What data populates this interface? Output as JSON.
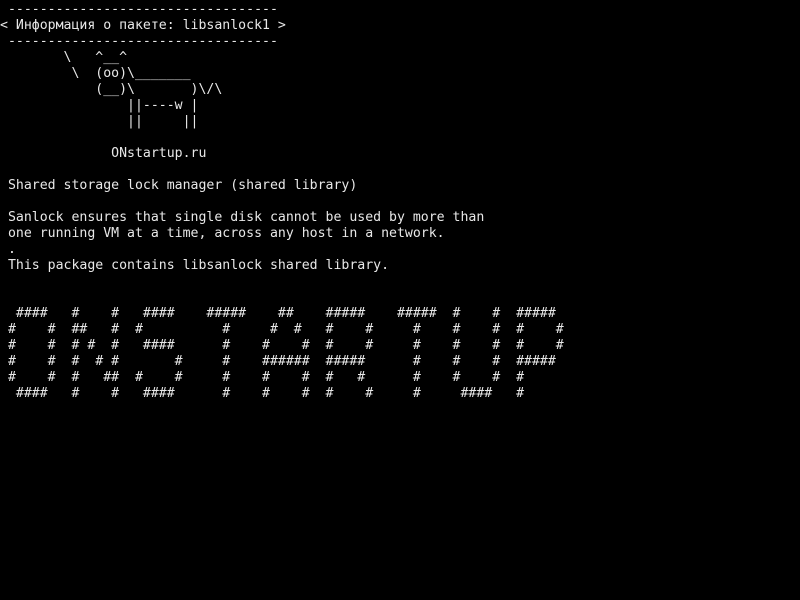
{
  "terminal": {
    "background_color": "#000000",
    "text_color": "#e8e8e8",
    "lines": [
      " ----------------------------------",
      "< Информация о пакете: libsanlock1 >",
      " ----------------------------------",
      "        \\   ^__^",
      "         \\  (oo)\\_______",
      "            (__)\\       )\\/\\",
      "                ||----w |",
      "                ||     ||",
      "",
      "              ONstartup.ru",
      "",
      " Shared storage lock manager (shared library)",
      "",
      " Sanlock ensures that single disk cannot be used by more than",
      " one running VM at a time, across any host in a network.",
      " .",
      " This package contains libsanlock shared library.",
      "",
      "",
      "  ####   #    #   ####    #####    ##    #####    #####  #    #  #####",
      " #    #  ##   #  #          #     #  #   #    #     #    #    #  #    #",
      " #    #  # #  #   ####      #    #    #  #    #     #    #    #  #    #",
      " #    #  #  # #       #     #    ######  #####      #    #    #  #####",
      " #    #  #   ##  #    #     #    #    #  #   #      #    #    #  #",
      "  ####   #    #   ####      #    #    #  #    #     #     ####   #"
    ]
  }
}
